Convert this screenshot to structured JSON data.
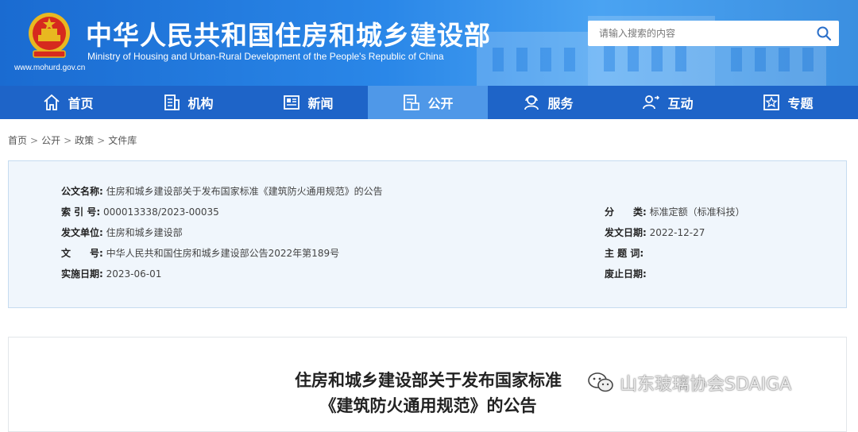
{
  "header": {
    "title": "中华人民共和国住房和城乡建设部",
    "subtitle": "Ministry of Housing and Urban-Rural Development of the People's Republic of China",
    "url": "www.mohurd.gov.cn",
    "search_placeholder": "请输入搜索的内容"
  },
  "nav": {
    "items": [
      {
        "label": "首页",
        "icon": "home-icon"
      },
      {
        "label": "机构",
        "icon": "building-icon"
      },
      {
        "label": "新闻",
        "icon": "news-icon"
      },
      {
        "label": "公开",
        "icon": "document-icon"
      },
      {
        "label": "服务",
        "icon": "service-icon"
      },
      {
        "label": "互动",
        "icon": "interact-icon"
      },
      {
        "label": "专题",
        "icon": "star-icon"
      }
    ],
    "active_index": 3
  },
  "breadcrumb": [
    "首页",
    "公开",
    "政策",
    "文件库"
  ],
  "info": {
    "doc_name_label": "公文名称:",
    "doc_name": "住房和城乡建设部关于发布国家标准《建筑防火通用规范》的公告",
    "index_label": "索 引 号:",
    "index": "000013338/2023-00035",
    "category_label": "分　　类:",
    "category": "标准定额（标准科技）",
    "issuer_label": "发文单位:",
    "issuer": "住房和城乡建设部",
    "date_label": "发文日期:",
    "date": "2022-12-27",
    "doc_no_label": "文　　号:",
    "doc_no": "中华人民共和国住房和城乡建设部公告2022年第189号",
    "keywords_label": "主 题 词:",
    "keywords": "",
    "effective_label": "实施日期:",
    "effective": "2023-06-01",
    "repeal_label": "废止日期:",
    "repeal": ""
  },
  "article": {
    "title_line1": "住房和城乡建设部关于发布国家标准",
    "title_line2": "《建筑防火通用规范》的公告"
  },
  "watermark": {
    "text": "山东玻璃协会SDAIGA"
  },
  "colors": {
    "header_blue": "#1a6bd1",
    "nav_blue": "#1e64c8",
    "nav_active": "#4f98e8",
    "info_bg": "#f0f6fc"
  }
}
